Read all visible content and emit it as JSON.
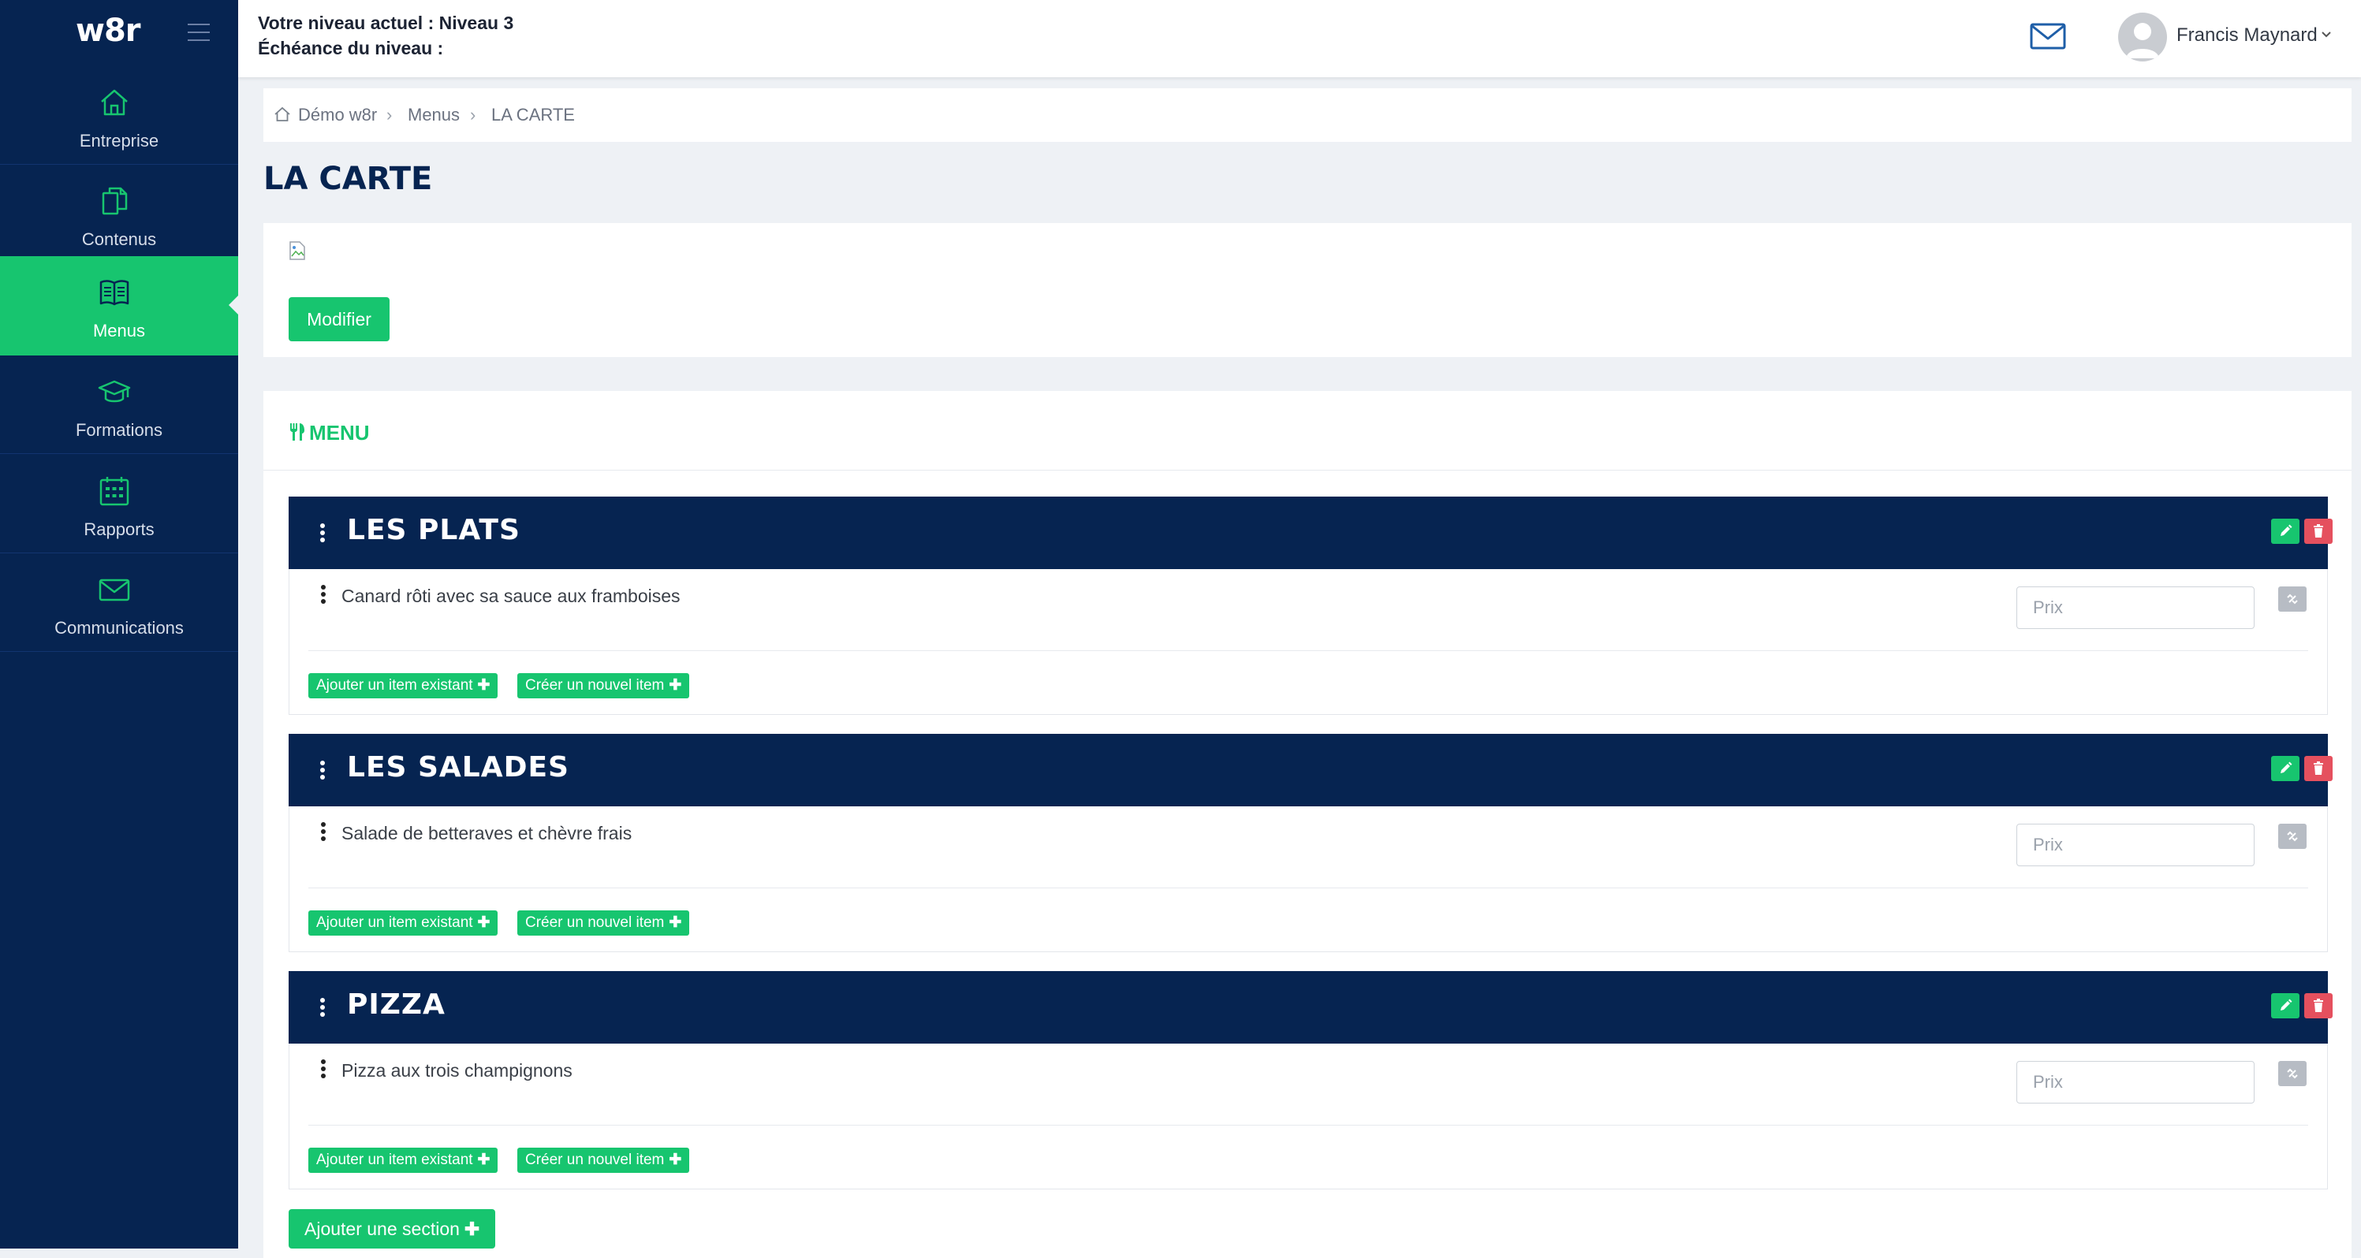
{
  "app": {
    "logo": "w8r"
  },
  "sidebar": {
    "items": [
      {
        "label": "Entreprise",
        "icon": "home-icon"
      },
      {
        "label": "Contenus",
        "icon": "documents-icon"
      },
      {
        "label": "Menus",
        "icon": "book-icon",
        "active": true
      },
      {
        "label": "Formations",
        "icon": "graduation-cap-icon"
      },
      {
        "label": "Rapports",
        "icon": "calendar-icon"
      },
      {
        "label": "Communications",
        "icon": "envelope-icon"
      }
    ]
  },
  "header": {
    "level_line": "Votre niveau actuel : Niveau 3",
    "deadline_line": "Échéance du niveau :",
    "user_name": "Francis Maynard"
  },
  "breadcrumb": [
    "Démo w8r",
    "Menus",
    "LA CARTE"
  ],
  "page": {
    "title": "LA CARTE",
    "modify_button": "Modifier"
  },
  "menu": {
    "title": "MENU",
    "sections": [
      {
        "title": "LES PLATS",
        "items": [
          {
            "name": "Canard rôti avec sa sauce aux framboises",
            "price_placeholder": "Prix"
          }
        ]
      },
      {
        "title": "LES SALADES",
        "items": [
          {
            "name": "Salade de betteraves et chèvre frais",
            "price_placeholder": "Prix"
          }
        ]
      },
      {
        "title": "PIZZA",
        "items": [
          {
            "name": "Pizza aux trois champignons",
            "price_placeholder": "Prix"
          }
        ]
      }
    ],
    "add_existing_label": "Ajouter un item existant",
    "create_new_label": "Créer un nouvel item",
    "add_section_label": "Ajouter une section"
  },
  "colors": {
    "navy": "#062451",
    "green": "#17c56f",
    "red": "#e5505e",
    "background": "#eef1f5"
  }
}
